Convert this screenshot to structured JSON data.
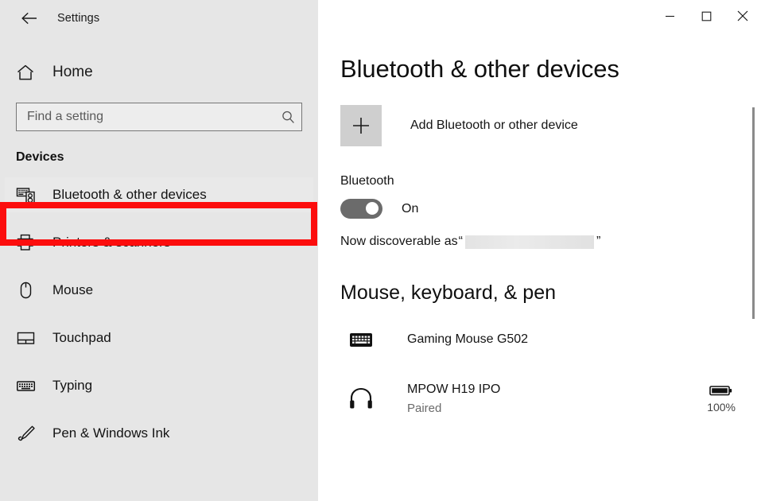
{
  "window": {
    "app_title": "Settings",
    "back_icon": "back-arrow-icon",
    "controls": {
      "minimize": "minimize-icon",
      "maximize": "maximize-icon",
      "close": "close-icon"
    }
  },
  "sidebar": {
    "home_label": "Home",
    "home_icon": "home-icon",
    "search": {
      "placeholder": "Find a setting",
      "value": "",
      "icon": "search-icon"
    },
    "section_header": "Devices",
    "items": [
      {
        "label": "Bluetooth & other devices",
        "icon": "bluetooth-devices-icon",
        "selected": true
      },
      {
        "label": "Printers & scanners",
        "icon": "printer-icon",
        "selected": false
      },
      {
        "label": "Mouse",
        "icon": "mouse-icon",
        "selected": false
      },
      {
        "label": "Touchpad",
        "icon": "touchpad-icon",
        "selected": false
      },
      {
        "label": "Typing",
        "icon": "keyboard-icon",
        "selected": false
      },
      {
        "label": "Pen & Windows Ink",
        "icon": "pen-icon",
        "selected": false
      }
    ]
  },
  "annotation": {
    "color": "#fc0d0d",
    "target": "Bluetooth & other devices"
  },
  "main": {
    "page_title": "Bluetooth & other devices",
    "add_device": {
      "label": "Add Bluetooth or other device",
      "icon": "plus-icon"
    },
    "bluetooth": {
      "header": "Bluetooth",
      "state": "On",
      "toggle_on": true,
      "discoverable_prefix": "Now discoverable as",
      "open_quote": "“",
      "close_quote": "”",
      "device_name_redacted": true
    },
    "devices_group": {
      "header": "Mouse, keyboard, & pen",
      "devices": [
        {
          "name": "Gaming Mouse G502",
          "status": "",
          "icon": "keyboard-icon",
          "battery": ""
        },
        {
          "name": "MPOW H19 IPO",
          "status": "Paired",
          "icon": "headphones-icon",
          "battery": "100%"
        }
      ]
    }
  }
}
